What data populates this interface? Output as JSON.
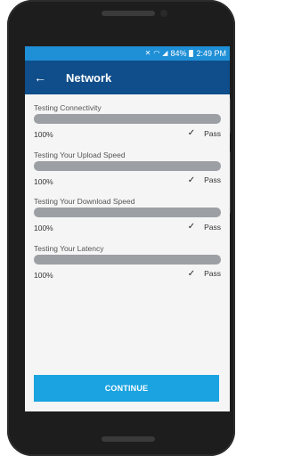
{
  "status_bar": {
    "battery": "84%",
    "time": "2:49 PM",
    "icons": [
      "mute-icon",
      "wifi-icon",
      "signal-icon",
      "battery-icon"
    ]
  },
  "app_bar": {
    "title": "Network",
    "back_icon": "arrow-left-icon"
  },
  "tests": [
    {
      "label": "Testing Connectivity",
      "percent": "100%",
      "progress": 1.0,
      "result": "Pass"
    },
    {
      "label": "Testing Your Upload Speed",
      "percent": "100%",
      "progress": 1.0,
      "result": "Pass"
    },
    {
      "label": "Testing Your Download Speed",
      "percent": "100%",
      "progress": 1.0,
      "result": "Pass"
    },
    {
      "label": "Testing Your Latency",
      "percent": "100%",
      "progress": 1.0,
      "result": "Pass"
    }
  ],
  "continue_label": "CONTINUE",
  "colors": {
    "status_bar": "#1f8fd6",
    "app_bar": "#0f4e8a",
    "progress_fill": "#9c9fa3",
    "button": "#1aa3e0"
  }
}
